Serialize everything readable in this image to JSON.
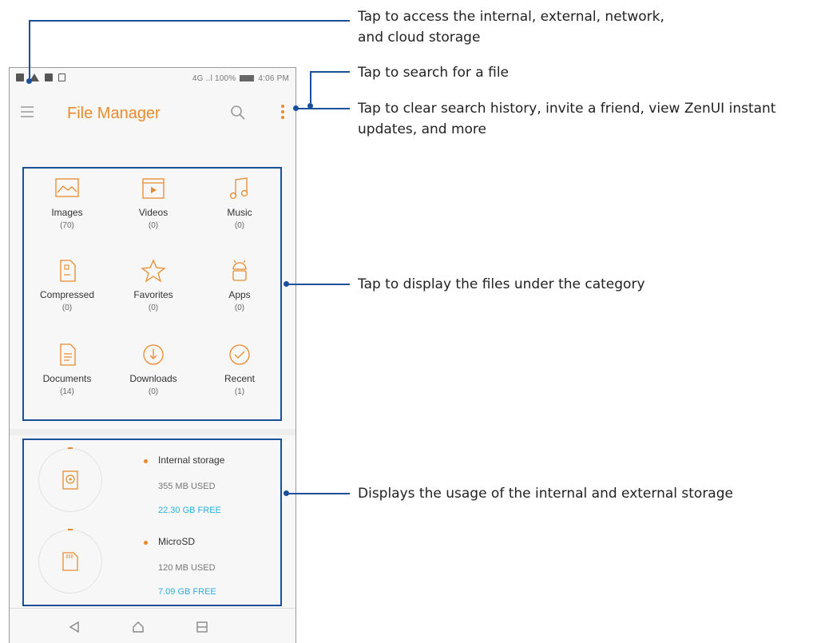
{
  "status_bar": {
    "network": "4G",
    "battery": "100%",
    "time": "4:06 PM"
  },
  "app_bar": {
    "title": "File Manager"
  },
  "categories": [
    {
      "label": "Images",
      "count": "(70)",
      "icon": "image-icon"
    },
    {
      "label": "Videos",
      "count": "(0)",
      "icon": "video-icon"
    },
    {
      "label": "Music",
      "count": "(0)",
      "icon": "music-icon"
    },
    {
      "label": "Compressed",
      "count": "(0)",
      "icon": "compressed-file-icon"
    },
    {
      "label": "Favorites",
      "count": "(0)",
      "icon": "star-icon"
    },
    {
      "label": "Apps",
      "count": "(0)",
      "icon": "android-icon"
    },
    {
      "label": "Documents",
      "count": "(14)",
      "icon": "document-icon"
    },
    {
      "label": "Downloads",
      "count": "(0)",
      "icon": "download-icon"
    },
    {
      "label": "Recent",
      "count": "(1)",
      "icon": "check-circle-icon"
    }
  ],
  "storage": [
    {
      "name": "Internal storage",
      "used": "355 MB USED",
      "free": "22.30 GB FREE",
      "icon": "internal-storage-icon"
    },
    {
      "name": "MicroSD",
      "used": "120 MB USED",
      "free": "7.09 GB FREE",
      "icon": "sd-card-icon"
    }
  ],
  "nav_bar": {
    "back": "back-icon",
    "home": "home-icon",
    "recents": "recents-icon"
  },
  "callouts": {
    "menu": "Tap to access the internal, external, network, and cloud storage",
    "menu_line1": "Tap to access the internal, external, network,",
    "menu_line2": "and cloud storage",
    "search": "Tap to search for a file",
    "more_line1": "Tap to clear search history, invite a friend, view ZenUI instant",
    "more_line2": "updates, and more",
    "category": "Tap to display the files under the category",
    "storage": "Displays the usage of the internal and external storage"
  },
  "colors": {
    "accent": "#e88a2b",
    "callout_line": "#1a4f9c",
    "free_text": "#29b0e0"
  }
}
